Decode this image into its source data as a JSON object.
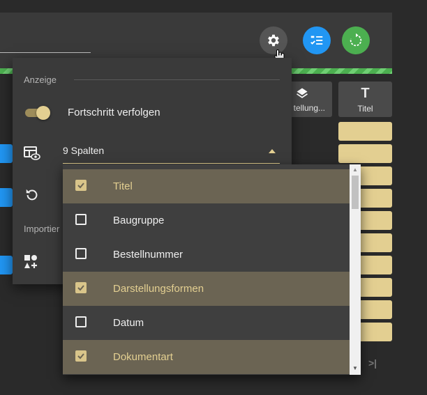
{
  "panel": {
    "section_display": "Anzeige",
    "toggle_label": "Fortschritt verfolgen",
    "toggle_on": true,
    "columns_value": "9 Spalten",
    "section_import": "Importier"
  },
  "grid": {
    "col_partial": "tellung...",
    "col_title": "Titel"
  },
  "dropdown": {
    "options": [
      {
        "label": "Titel",
        "checked": true
      },
      {
        "label": "Baugruppe",
        "checked": false
      },
      {
        "label": "Bestellnummer",
        "checked": false
      },
      {
        "label": "Darstellungsformen",
        "checked": true
      },
      {
        "label": "Datum",
        "checked": false
      },
      {
        "label": "Dokumentart",
        "checked": true
      }
    ]
  },
  "icons": [
    "gear-icon",
    "checklist-icon",
    "refresh-icon",
    "layers-icon",
    "text-icon",
    "table-settings-icon",
    "reset-icon",
    "shapes-add-icon",
    "last-page-icon",
    "hand-cursor-icon"
  ],
  "colors": {
    "accent": "#e3cf91",
    "blue": "#2196f3",
    "green": "#4caf50",
    "selected_row": "#6b6453"
  }
}
